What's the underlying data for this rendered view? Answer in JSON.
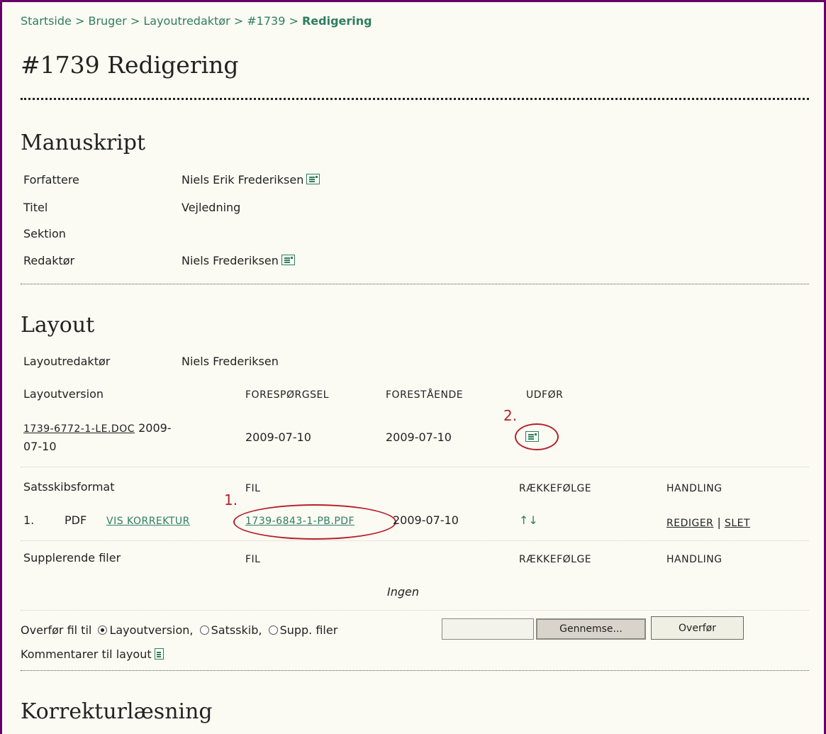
{
  "breadcrumb": {
    "items": [
      "Startside",
      "Bruger",
      "Layoutredaktør",
      "#1739"
    ],
    "separator": ">",
    "current": "Redigering"
  },
  "page_title": "#1739 Redigering",
  "manuscript": {
    "heading": "Manuskript",
    "rows": [
      {
        "label": "Forfattere",
        "value": "Niels Erik Frederiksen",
        "icon": "mail-icon"
      },
      {
        "label": "Titel",
        "value": "Vejledning"
      },
      {
        "label": "Sektion",
        "value": ""
      },
      {
        "label": "Redaktør",
        "value": "Niels Frederiksen",
        "icon": "mail-icon"
      }
    ]
  },
  "layout": {
    "heading": "Layout",
    "editor_label": "Layoutredaktør",
    "editor_value": "Niels Frederiksen",
    "version": {
      "label": "Layoutversion",
      "col_request": "FORESPØRGSEL",
      "col_pending": "FORESTÅENDE",
      "col_do": "UDFØR",
      "file_link": "1739-6772-1-LE.DOC",
      "file_date_part1": "2009-",
      "file_date_part2": "07-10",
      "request_date": "2009-07-10",
      "pending_date": "2009-07-10"
    },
    "galley": {
      "label": "Satsskibsformat",
      "col_file": "FIL",
      "col_order": "RÆKKEFØLGE",
      "col_action": "HANDLING",
      "row_num": "1.",
      "format": "PDF",
      "view_proof": "VIS KORREKTUR",
      "file_link": "1739-6843-1-PB.PDF",
      "date": "2009-07-10",
      "order_arrows": "↑↓",
      "edit": "REDIGER",
      "sep": "|",
      "delete": "SLET"
    },
    "supp": {
      "label": "Supplerende filer",
      "col_file": "FIL",
      "col_order": "RÆKKEFØLGE",
      "col_action": "HANDLING",
      "none": "Ingen"
    },
    "upload": {
      "label": "Overfør fil til",
      "opt1": "Layoutversion,",
      "opt2": "Satsskib,",
      "opt3": "Supp. filer",
      "selected": "Layoutversion",
      "browse": "Gennemse...",
      "submit": "Overfør"
    },
    "comments": "Kommentarer til layout"
  },
  "annotations": {
    "a1": "1.",
    "a2": "2."
  },
  "proofreading": {
    "heading": "Korrekturlæsning"
  },
  "colors": {
    "link": "#2f7d63",
    "frame": "#660066",
    "annotation": "#b5202a",
    "background": "#fbfbf3"
  }
}
